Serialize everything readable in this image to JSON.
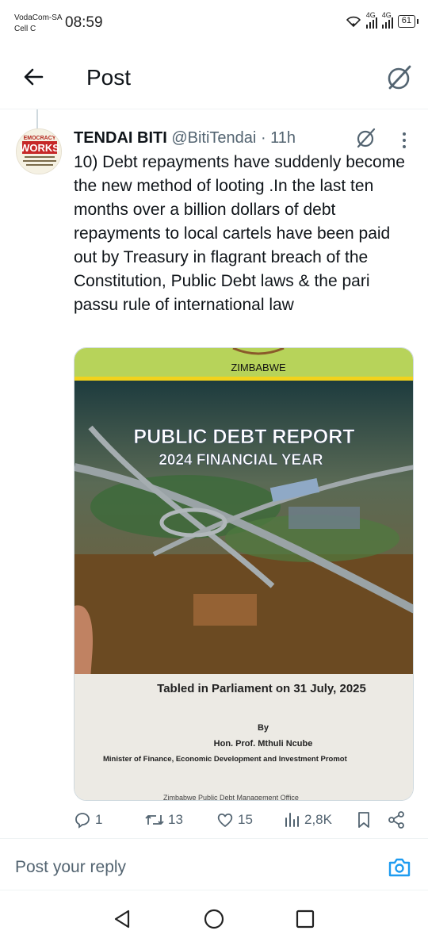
{
  "status_bar": {
    "carrier_line1": "VodaCom-SA",
    "carrier_line2": "Cell C",
    "time": "08:59",
    "network1": "4G",
    "network2": "4G",
    "battery": "61"
  },
  "header": {
    "title": "Post",
    "back_icon": "back-arrow-icon",
    "grok_icon": "grok-icon"
  },
  "post": {
    "display_name": "TENDAI BITI",
    "handle": "@BitiTendai",
    "separator": "·",
    "time_ago": "11h",
    "text": "10) Debt repayments have suddenly become the new method of looting .In the last ten months over a billion dollars of debt repayments to local cartels have been paid out by Treasury in flagrant breach of the Constitution, Public Debt laws & the pari passu rule of international law",
    "avatar": {
      "line1": "EMOCRACY",
      "line2": "WORKS"
    },
    "image": {
      "country": "ZIMBABWE",
      "title": "PUBLIC DEBT REPORT",
      "subtitle": "2024 FINANCIAL YEAR",
      "tabled": "Tabled in Parliament on 31 July, 2025",
      "by": "By",
      "minister_name": "Hon. Prof. Mthuli Ncube",
      "minister_title": "Minister of Finance, Economic Development and Investment Promot",
      "office": "Zimbabwe Public Debt Management Office"
    },
    "metrics": {
      "replies": "1",
      "reposts": "13",
      "likes": "15",
      "views": "2,8K"
    }
  },
  "reply_bar": {
    "placeholder": "Post your reply"
  },
  "colors": {
    "text": "#0f1419",
    "secondary": "#536471",
    "accent": "#1d9bf0",
    "border": "#eff3f4"
  }
}
